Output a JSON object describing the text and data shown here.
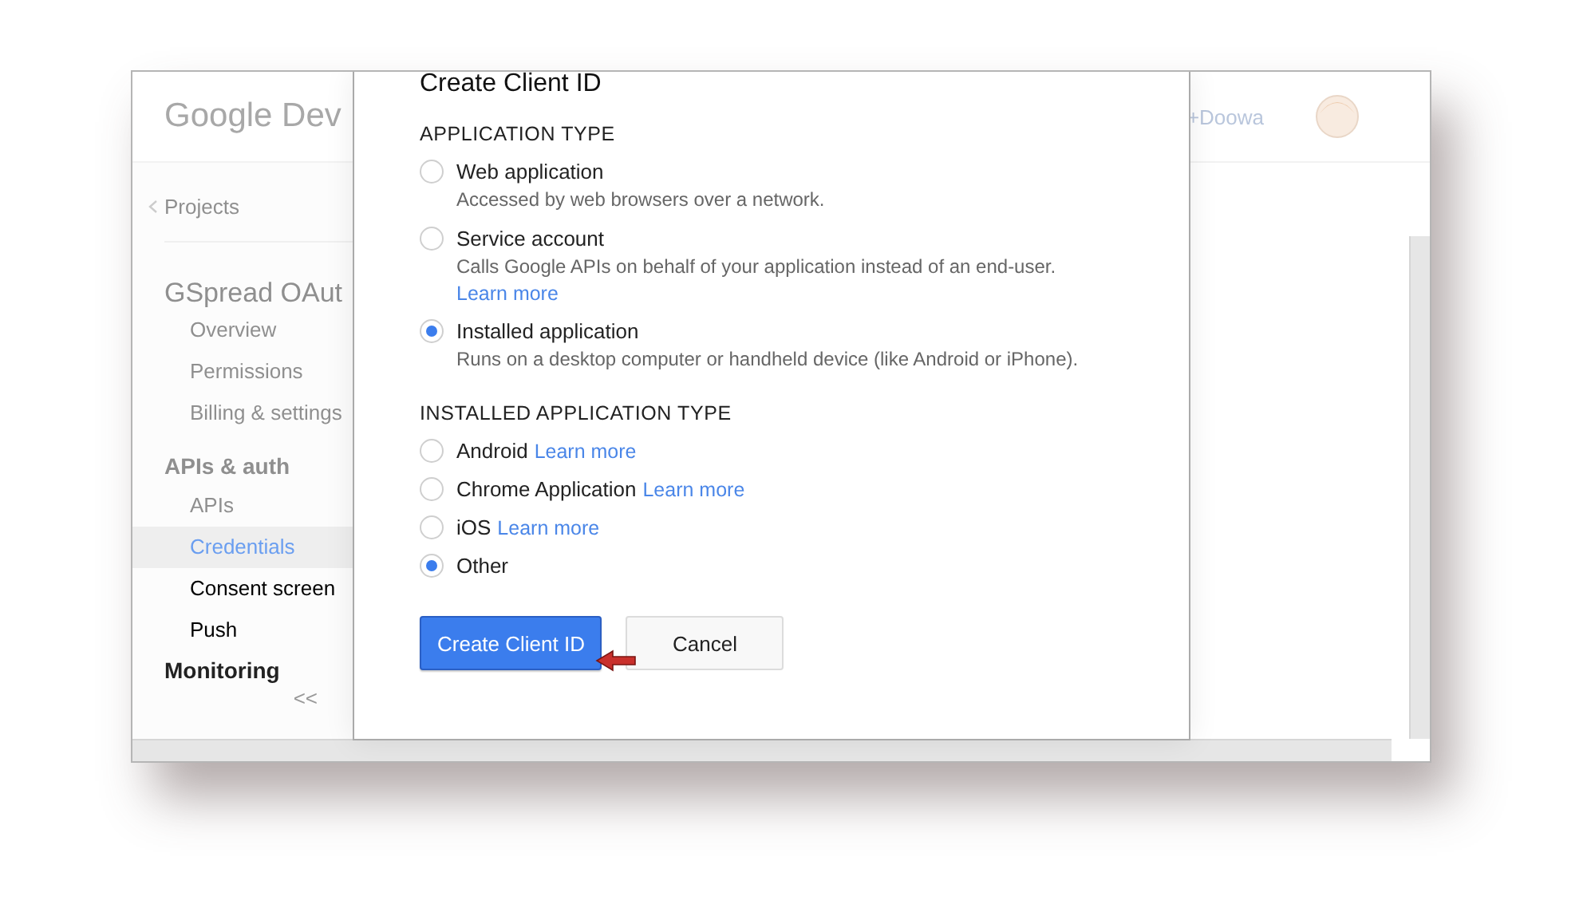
{
  "header": {
    "logo": "Google Dev",
    "user": "+Doowa"
  },
  "sidebar": {
    "back": "Projects",
    "project": "GSpread OAut",
    "project_items": [
      {
        "label": "Overview",
        "selected": false,
        "dimmed": true
      },
      {
        "label": "Permissions",
        "selected": false,
        "dimmed": true
      },
      {
        "label": "Billing & settings",
        "selected": false,
        "dimmed": true
      }
    ],
    "section": "APIs & auth",
    "section_items": [
      {
        "label": "APIs",
        "selected": false,
        "dimmed": true
      },
      {
        "label": "Credentials",
        "selected": true,
        "dimmed": false
      },
      {
        "label": "Consent screen",
        "selected": false,
        "dimmed": false
      },
      {
        "label": "Push",
        "selected": false,
        "dimmed": false
      }
    ],
    "next_section": "Monitoring",
    "collapse": "<<"
  },
  "dialog": {
    "title": "Create Client ID",
    "sections": [
      {
        "heading": "APPLICATION TYPE",
        "options": [
          {
            "kind": "described",
            "label": "Web application",
            "description": "Accessed by web browsers over a network.",
            "selected": false
          },
          {
            "kind": "described",
            "label": "Service account",
            "description": "Calls Google APIs on behalf of your application instead of an end-user.",
            "link": "Learn more",
            "selected": false
          },
          {
            "kind": "described",
            "label": "Installed application",
            "description": "Runs on a desktop computer or handheld device (like Android or iPhone).",
            "selected": true
          }
        ]
      },
      {
        "heading": "INSTALLED APPLICATION TYPE",
        "options": [
          {
            "kind": "inline",
            "label": "Android",
            "link": "Learn more",
            "selected": false
          },
          {
            "kind": "inline",
            "label": "Chrome Application",
            "link": "Learn more",
            "selected": false
          },
          {
            "kind": "inline",
            "label": "iOS",
            "link": "Learn more",
            "selected": false
          },
          {
            "kind": "inline",
            "label": "Other",
            "selected": true
          }
        ]
      }
    ],
    "buttons": [
      {
        "label": "Create Client ID",
        "kind": "primary"
      },
      {
        "label": "Cancel",
        "kind": "secondary"
      }
    ]
  }
}
